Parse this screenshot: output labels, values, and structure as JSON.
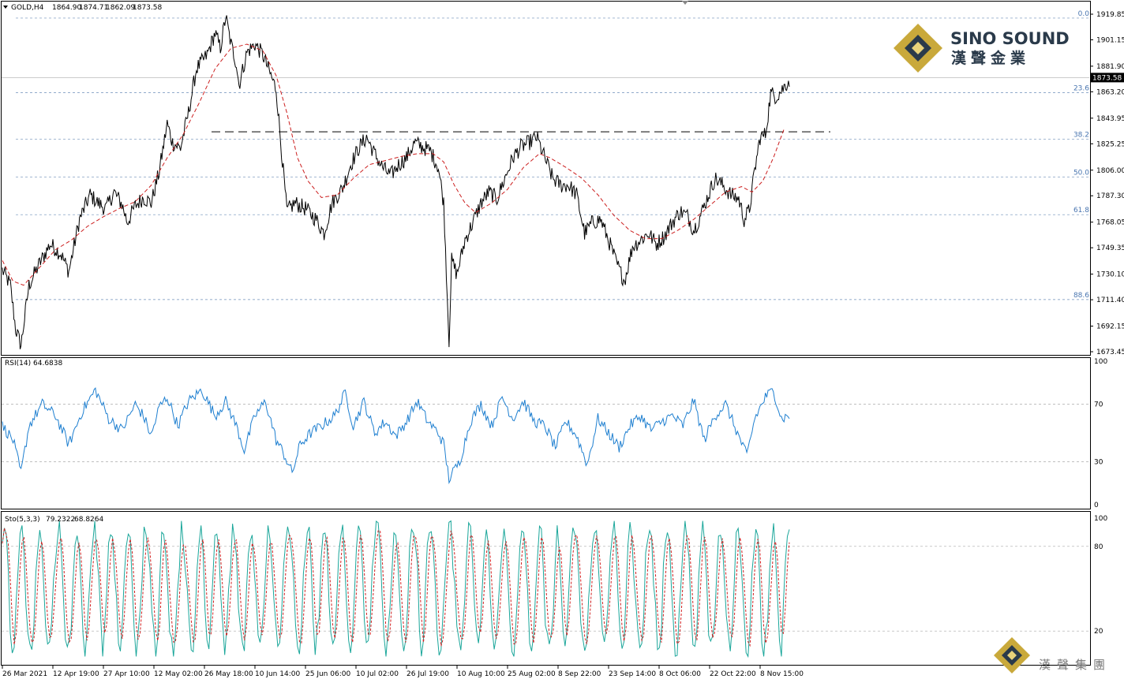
{
  "chart_data": {
    "type": "line",
    "symbol": "GOLD,H4",
    "ohlc": [
      "1864.90",
      "1874.71",
      "1862.09",
      "1873.58"
    ],
    "last_price": "1873.58",
    "price_ticks": [
      "1919.85",
      "1901.15",
      "1881.90",
      "1863.20",
      "1843.95",
      "1825.25",
      "1806.00",
      "1787.30",
      "1768.05",
      "1749.35",
      "1730.10",
      "1711.40",
      "1692.15",
      "1673.45"
    ],
    "x_ticks": [
      "26 Mar 2021",
      "12 Apr 19:00",
      "27 Apr 10:00",
      "12 May 02:00",
      "26 May 18:00",
      "10 Jun 14:00",
      "25 Jun 06:00",
      "10 Jul 02:00",
      "26 Jul 19:00",
      "10 Aug 10:00",
      "25 Aug 02:00",
      "8 Sep 22:00",
      "23 Sep 14:00",
      "8 Oct 06:00",
      "22 Oct 22:00",
      "8 Nov 15:00"
    ],
    "fib_levels": [
      {
        "label": "0.0",
        "price": 1917
      },
      {
        "label": "23.6",
        "price": 1862.5
      },
      {
        "label": "38.2",
        "price": 1828.5
      },
      {
        "label": "50.0",
        "price": 1801
      },
      {
        "label": "61.8",
        "price": 1773.5
      },
      {
        "label": "88.6",
        "price": 1711.5
      }
    ],
    "resistance_level": 1834,
    "ylim": [
      1670,
      1925
    ],
    "price_path": [
      [
        0,
        1733
      ],
      [
        3,
        1722
      ],
      [
        5,
        1690
      ],
      [
        7,
        1678
      ],
      [
        10,
        1722
      ],
      [
        14,
        1738
      ],
      [
        18,
        1752
      ],
      [
        22,
        1745
      ],
      [
        25,
        1732
      ],
      [
        29,
        1770
      ],
      [
        33,
        1788
      ],
      [
        36,
        1782
      ],
      [
        39,
        1778
      ],
      [
        42,
        1790
      ],
      [
        45,
        1781
      ],
      [
        47,
        1768
      ],
      [
        50,
        1780
      ],
      [
        53,
        1786
      ],
      [
        56,
        1782
      ],
      [
        59,
        1805
      ],
      [
        62,
        1840
      ],
      [
        64,
        1826
      ],
      [
        67,
        1822
      ],
      [
        70,
        1848
      ],
      [
        73,
        1880
      ],
      [
        77,
        1890
      ],
      [
        80,
        1906
      ],
      [
        82,
        1895
      ],
      [
        84,
        1918
      ],
      [
        86,
        1898
      ],
      [
        88,
        1884
      ],
      [
        89,
        1868
      ],
      [
        92,
        1892
      ],
      [
        95,
        1898
      ],
      [
        98,
        1890
      ],
      [
        101,
        1875
      ],
      [
        103,
        1865
      ],
      [
        105,
        1820
      ],
      [
        107,
        1776
      ],
      [
        110,
        1782
      ],
      [
        114,
        1778
      ],
      [
        118,
        1770
      ],
      [
        121,
        1760
      ],
      [
        124,
        1782
      ],
      [
        128,
        1793
      ],
      [
        131,
        1810
      ],
      [
        134,
        1822
      ],
      [
        137,
        1830
      ],
      [
        140,
        1818
      ],
      [
        143,
        1808
      ],
      [
        146,
        1802
      ],
      [
        149,
        1810
      ],
      [
        152,
        1815
      ],
      [
        155,
        1826
      ],
      [
        158,
        1823
      ],
      [
        161,
        1820
      ],
      [
        164,
        1808
      ],
      [
        166,
        1782
      ],
      [
        168,
        1682
      ],
      [
        169,
        1740
      ],
      [
        171,
        1730
      ],
      [
        174,
        1755
      ],
      [
        177,
        1768
      ],
      [
        180,
        1782
      ],
      [
        183,
        1790
      ],
      [
        186,
        1785
      ],
      [
        189,
        1800
      ],
      [
        192,
        1815
      ],
      [
        195,
        1823
      ],
      [
        198,
        1826
      ],
      [
        201,
        1830
      ],
      [
        204,
        1815
      ],
      [
        207,
        1800
      ],
      [
        210,
        1795
      ],
      [
        213,
        1795
      ],
      [
        216,
        1788
      ],
      [
        219,
        1760
      ],
      [
        222,
        1768
      ],
      [
        225,
        1770
      ],
      [
        228,
        1755
      ],
      [
        231,
        1738
      ],
      [
        234,
        1725
      ],
      [
        237,
        1750
      ],
      [
        240,
        1755
      ],
      [
        243,
        1760
      ],
      [
        246,
        1752
      ],
      [
        249,
        1758
      ],
      [
        252,
        1768
      ],
      [
        255,
        1776
      ],
      [
        258,
        1772
      ],
      [
        260,
        1762
      ],
      [
        262,
        1770
      ],
      [
        265,
        1785
      ],
      [
        268,
        1800
      ],
      [
        271,
        1795
      ],
      [
        274,
        1788
      ],
      [
        277,
        1785
      ],
      [
        279,
        1770
      ],
      [
        281,
        1777
      ],
      [
        283,
        1806
      ],
      [
        285,
        1830
      ],
      [
        287,
        1832
      ],
      [
        289,
        1862
      ],
      [
        291,
        1860
      ],
      [
        293,
        1864
      ],
      [
        296,
        1872
      ]
    ],
    "ma_path": [
      [
        0,
        1740
      ],
      [
        4,
        1725
      ],
      [
        8,
        1722
      ],
      [
        14,
        1735
      ],
      [
        20,
        1748
      ],
      [
        26,
        1755
      ],
      [
        32,
        1765
      ],
      [
        38,
        1772
      ],
      [
        44,
        1778
      ],
      [
        50,
        1783
      ],
      [
        56,
        1795
      ],
      [
        62,
        1815
      ],
      [
        68,
        1832
      ],
      [
        74,
        1855
      ],
      [
        80,
        1880
      ],
      [
        86,
        1895
      ],
      [
        92,
        1898
      ],
      [
        98,
        1893
      ],
      [
        103,
        1875
      ],
      [
        107,
        1848
      ],
      [
        111,
        1815
      ],
      [
        115,
        1798
      ],
      [
        120,
        1786
      ],
      [
        126,
        1788
      ],
      [
        132,
        1800
      ],
      [
        138,
        1810
      ],
      [
        144,
        1813
      ],
      [
        150,
        1816
      ],
      [
        156,
        1818
      ],
      [
        162,
        1818
      ],
      [
        166,
        1812
      ],
      [
        170,
        1795
      ],
      [
        174,
        1782
      ],
      [
        178,
        1775
      ],
      [
        184,
        1782
      ],
      [
        190,
        1792
      ],
      [
        196,
        1808
      ],
      [
        202,
        1818
      ],
      [
        206,
        1815
      ],
      [
        212,
        1808
      ],
      [
        218,
        1800
      ],
      [
        224,
        1788
      ],
      [
        230,
        1773
      ],
      [
        236,
        1762
      ],
      [
        242,
        1756
      ],
      [
        248,
        1756
      ],
      [
        254,
        1762
      ],
      [
        260,
        1770
      ],
      [
        266,
        1780
      ],
      [
        272,
        1790
      ],
      [
        278,
        1794
      ],
      [
        282,
        1790
      ],
      [
        286,
        1798
      ],
      [
        290,
        1815
      ],
      [
        294,
        1836
      ]
    ],
    "rsi": {
      "label": "RSI(14)",
      "value": "64.6838",
      "ticks": [
        "100",
        "70",
        "30",
        "0"
      ],
      "levels": [
        70,
        30
      ],
      "ylim": [
        0,
        100
      ],
      "path": [
        [
          0,
          55
        ],
        [
          4,
          45
        ],
        [
          7,
          22
        ],
        [
          10,
          55
        ],
        [
          15,
          70
        ],
        [
          20,
          62
        ],
        [
          25,
          42
        ],
        [
          30,
          65
        ],
        [
          35,
          80
        ],
        [
          40,
          60
        ],
        [
          45,
          52
        ],
        [
          50,
          70
        ],
        [
          53,
          62
        ],
        [
          56,
          48
        ],
        [
          59,
          68
        ],
        [
          62,
          75
        ],
        [
          66,
          55
        ],
        [
          70,
          72
        ],
        [
          75,
          80
        ],
        [
          80,
          62
        ],
        [
          84,
          72
        ],
        [
          88,
          55
        ],
        [
          91,
          38
        ],
        [
          95,
          62
        ],
        [
          99,
          72
        ],
        [
          103,
          45
        ],
        [
          106,
          35
        ],
        [
          109,
          22
        ],
        [
          112,
          42
        ],
        [
          116,
          50
        ],
        [
          120,
          55
        ],
        [
          125,
          62
        ],
        [
          129,
          78
        ],
        [
          132,
          55
        ],
        [
          136,
          72
        ],
        [
          140,
          50
        ],
        [
          144,
          58
        ],
        [
          148,
          48
        ],
        [
          152,
          58
        ],
        [
          156,
          72
        ],
        [
          160,
          58
        ],
        [
          164,
          50
        ],
        [
          166,
          42
        ],
        [
          168,
          18
        ],
        [
          172,
          30
        ],
        [
          176,
          58
        ],
        [
          180,
          70
        ],
        [
          184,
          55
        ],
        [
          188,
          75
        ],
        [
          192,
          60
        ],
        [
          196,
          72
        ],
        [
          200,
          58
        ],
        [
          204,
          55
        ],
        [
          208,
          40
        ],
        [
          212,
          58
        ],
        [
          216,
          48
        ],
        [
          220,
          28
        ],
        [
          224,
          60
        ],
        [
          228,
          50
        ],
        [
          232,
          40
        ],
        [
          236,
          55
        ],
        [
          240,
          62
        ],
        [
          244,
          52
        ],
        [
          248,
          58
        ],
        [
          252,
          62
        ],
        [
          256,
          55
        ],
        [
          260,
          73
        ],
        [
          264,
          45
        ],
        [
          268,
          62
        ],
        [
          272,
          70
        ],
        [
          276,
          52
        ],
        [
          280,
          34
        ],
        [
          283,
          60
        ],
        [
          287,
          75
        ],
        [
          290,
          80
        ],
        [
          293,
          60
        ],
        [
          296,
          62
        ]
      ]
    },
    "stochastic": {
      "label": "Sto(5,3,3)",
      "main": "79.2322",
      "signal": "68.8264",
      "ticks": [
        "100",
        "80",
        "20"
      ],
      "levels": [
        80,
        20
      ],
      "ylim": [
        0,
        100
      ]
    }
  },
  "watermarks": {
    "brand_en": "SINO SOUND",
    "brand_cn": "漢聲金業",
    "corner_cn": "漢聲集團"
  }
}
